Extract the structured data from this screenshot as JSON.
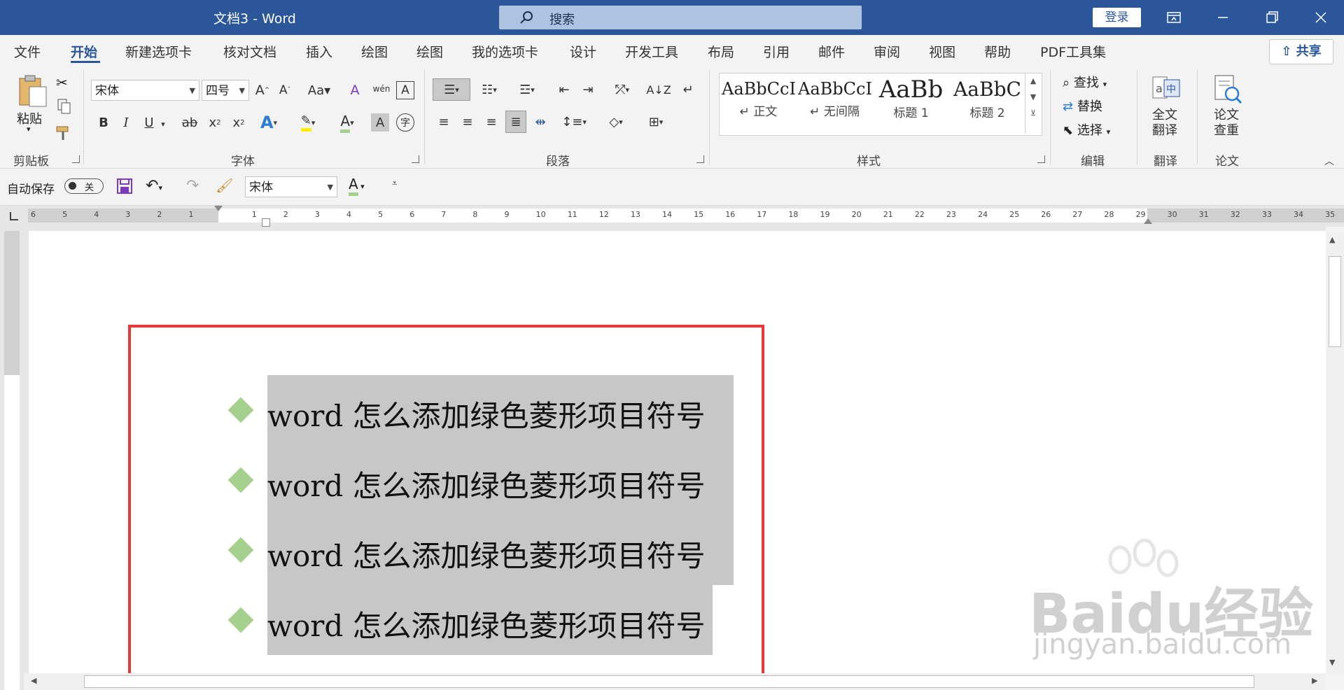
{
  "titlebar": {
    "title": "文档3  -  Word",
    "search_placeholder": "搜索",
    "login": "登录"
  },
  "tabs": [
    {
      "label": "文件"
    },
    {
      "label": "开始"
    },
    {
      "label": "新建选项卡"
    },
    {
      "label": "核对文档"
    },
    {
      "label": "插入"
    },
    {
      "label": "绘图"
    },
    {
      "label": "绘图"
    },
    {
      "label": "我的选项卡"
    },
    {
      "label": "设计"
    },
    {
      "label": "开发工具"
    },
    {
      "label": "布局"
    },
    {
      "label": "引用"
    },
    {
      "label": "邮件"
    },
    {
      "label": "审阅"
    },
    {
      "label": "视图"
    },
    {
      "label": "帮助"
    },
    {
      "label": "PDF工具集"
    }
  ],
  "share": "共享",
  "ribbon": {
    "clipboard": {
      "paste": "粘贴",
      "label": "剪贴板"
    },
    "font": {
      "name": "宋体",
      "size": "四号",
      "label": "字体"
    },
    "paragraph": {
      "label": "段落"
    },
    "styles": {
      "label": "样式",
      "items": [
        {
          "sample": "AaBbCcI",
          "name": "正文"
        },
        {
          "sample": "AaBbCcI",
          "name": "无间隔"
        },
        {
          "sample": "AaBb",
          "name": "标题 1"
        },
        {
          "sample": "AaBbC",
          "name": "标题 2"
        }
      ]
    },
    "editing": {
      "find": "查找",
      "replace": "替换",
      "select": "选择",
      "label": "编辑"
    },
    "translate": {
      "line1": "全文",
      "line2": "翻译",
      "label": "翻译"
    },
    "paper": {
      "line1": "论文",
      "line2": "查重",
      "label": "论文"
    }
  },
  "qat": {
    "autosave": "自动保存",
    "toggle": "关",
    "font": "宋体"
  },
  "ruler_numbers": [
    "6",
    "5",
    "4",
    "3",
    "2",
    "1",
    "",
    "1",
    "2",
    "3",
    "4",
    "5",
    "6",
    "7",
    "8",
    "9",
    "10",
    "11",
    "12",
    "13",
    "14",
    "15",
    "16",
    "17",
    "18",
    "19",
    "20",
    "21",
    "22",
    "23",
    "24",
    "25",
    "26",
    "27",
    "28",
    "29",
    "30",
    "31",
    "32",
    "33",
    "34",
    "35"
  ],
  "document": {
    "lines": [
      "word 怎么添加绿色菱形项目符号",
      "word 怎么添加绿色菱形项目符号",
      "word 怎么添加绿色菱形项目符号",
      "word 怎么添加绿色菱形项目符号"
    ],
    "bullet_color": "#a6d08e",
    "highlight_color": "#c7c7c7",
    "frame_color": "#e53935"
  },
  "watermark": {
    "brand": "Baidu经验",
    "url": "jingyan.baidu.com"
  }
}
